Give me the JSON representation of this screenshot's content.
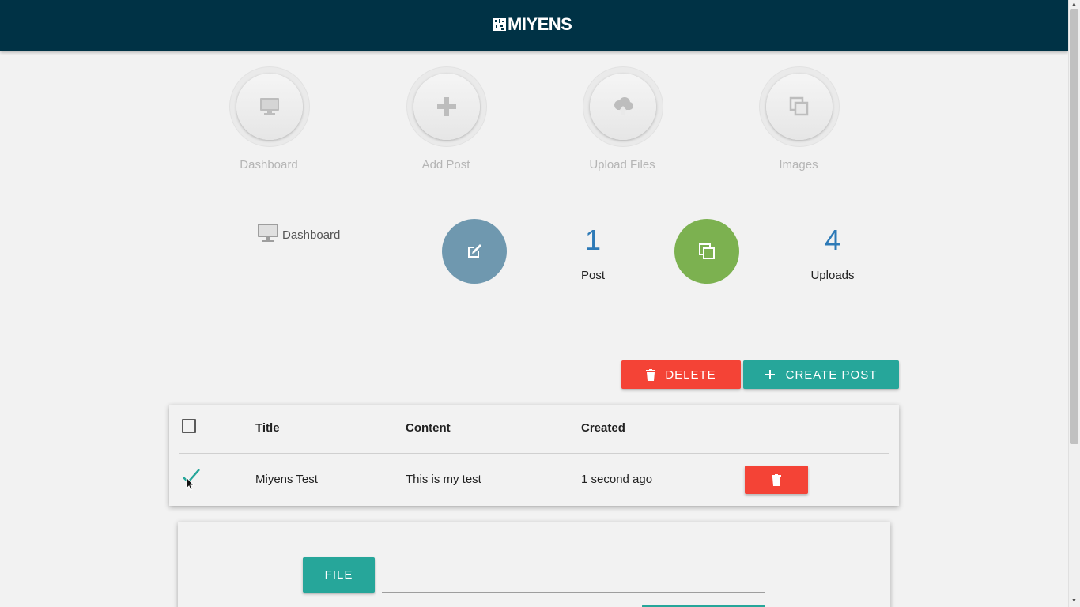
{
  "header": {
    "logo_text": "MIYENS",
    "bg": "#003245"
  },
  "nav": [
    {
      "label": "Dashboard",
      "icon": "monitor-icon"
    },
    {
      "label": "Add Post",
      "icon": "plus-icon"
    },
    {
      "label": "Upload Files",
      "icon": "cloud-upload-icon"
    },
    {
      "label": "Images",
      "icon": "images-icon"
    }
  ],
  "dashboard": {
    "title": "Dashboard",
    "stats": [
      {
        "value": "1",
        "label": "Post",
        "icon": "edit-icon",
        "color": "#6f98af"
      },
      {
        "value": "4",
        "label": "Uploads",
        "icon": "images-icon",
        "color": "#7cb150"
      }
    ]
  },
  "actions": {
    "delete_label": "DELETE",
    "create_label": "CREATE POST"
  },
  "table": {
    "columns": [
      "Title",
      "Content",
      "Created"
    ],
    "rows": [
      {
        "checked": true,
        "title": "Miyens Test",
        "content": "This is my test",
        "created": "1 second ago"
      }
    ]
  },
  "upload": {
    "file_button_label": "FILE",
    "file_value": ""
  },
  "colors": {
    "red": "#f44336",
    "teal": "#26a69a",
    "stat_number": "#2d7ab7"
  }
}
